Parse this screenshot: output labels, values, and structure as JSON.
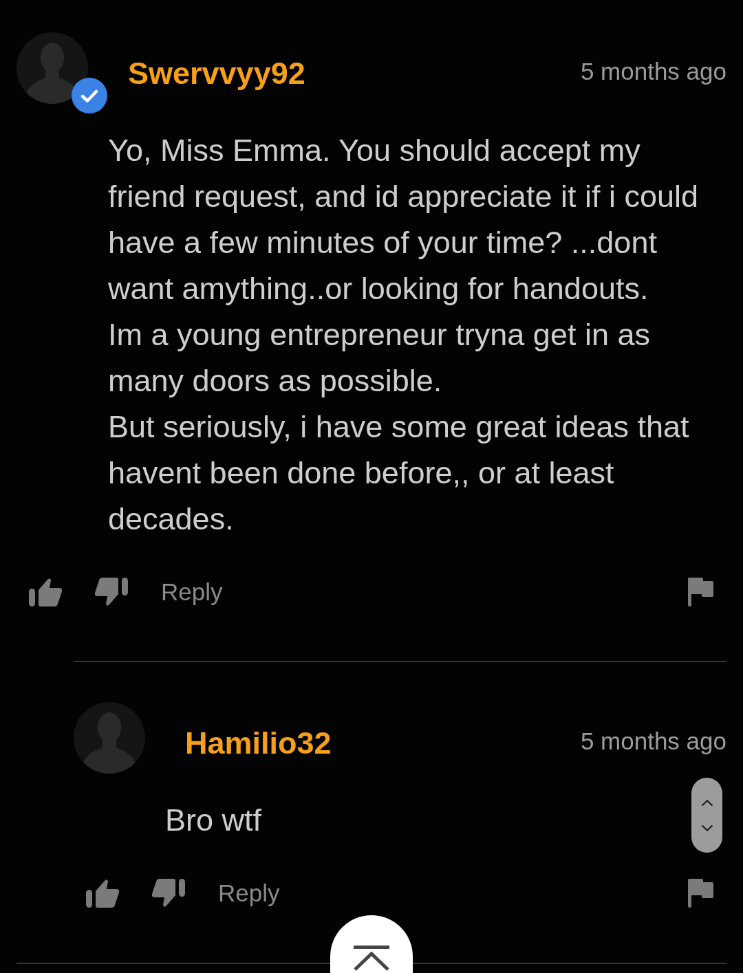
{
  "comments": [
    {
      "username": "Swervvyy92",
      "verified": true,
      "time": "5 months ago",
      "text": "Yo, Miss Emma. You should accept my friend request, and id appreciate it if i could have a few minutes of your time? ...dont want amything..or looking for handouts.\nIm a young entrepreneur tryna get in as many doors as possible.\nBut seriously, i have some great ideas that havent been done before,, or at least decades.",
      "reply_label": "Reply",
      "replies": [
        {
          "username": "Hamilio32",
          "verified": false,
          "time": "5 months ago",
          "text": "Bro wtf",
          "reply_label": "Reply"
        }
      ]
    }
  ]
}
